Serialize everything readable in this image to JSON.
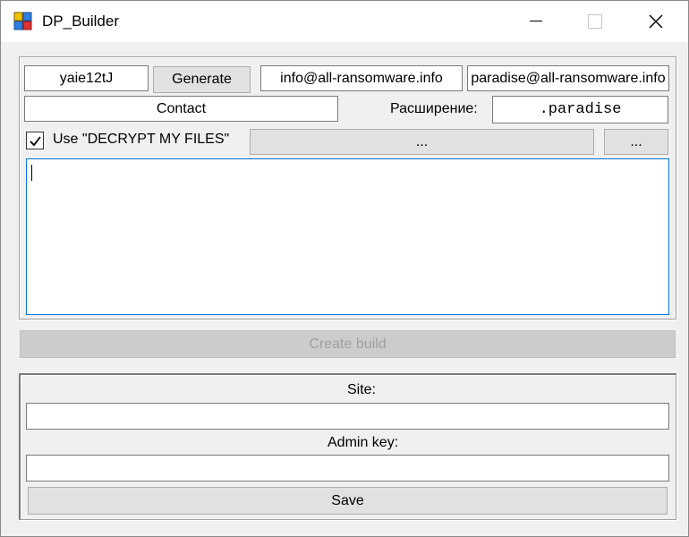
{
  "window": {
    "title": "DP_Builder"
  },
  "icons": {
    "app": "app-grid-icon",
    "minimize": "minimize-icon",
    "maximize": "maximize-icon",
    "close": "close-icon",
    "checkmark": "checkmark-icon"
  },
  "config": {
    "id_value": "yaie12tJ",
    "generate_label": "Generate",
    "email1": "info@all-ransomware.info",
    "email2": "paradise@all-ransomware.info",
    "contact_value": "Contact",
    "extension_label": "Расширение:",
    "extension_value": ".paradise",
    "decrypt_checkbox_label": "Use \"DECRYPT MY FILES\"",
    "decrypt_checked": true,
    "path_button_label": "...",
    "browse_button_label": "...",
    "message_text": ""
  },
  "create_build_label": "Create build",
  "panel": {
    "site_label": "Site:",
    "site_value": "",
    "admin_key_label": "Admin key:",
    "admin_key_value": "",
    "save_label": "Save"
  },
  "colors": {
    "window_bg": "#f0f0f0",
    "titlebar_bg": "#ffffff",
    "focus_border": "#0078d7",
    "button_bg": "#e1e1e1",
    "disabled_text": "#a0a0a0"
  }
}
